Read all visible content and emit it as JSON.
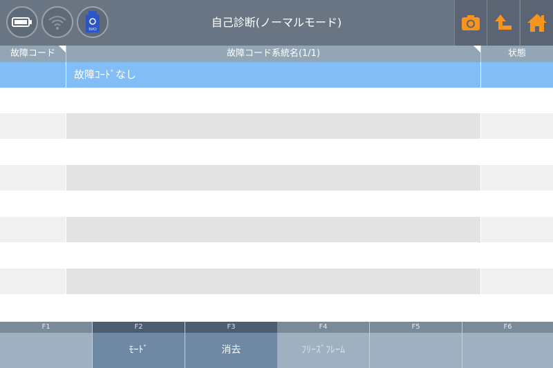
{
  "header": {
    "title": "自己診断(ノーマルモード)",
    "status_icons": [
      "battery-icon",
      "wifi-icon",
      "vci-device-icon"
    ],
    "vci_label": "SVCI",
    "actions": [
      "camera-icon",
      "back-up-icon",
      "home-icon"
    ],
    "accent": "#f7941d"
  },
  "table": {
    "columns": {
      "code": "故障コード",
      "name": "故障コード系統名(1/1)",
      "status": "状態"
    },
    "rows": [
      {
        "code": "",
        "name": "故障ｺｰﾄﾞなし",
        "status": ""
      }
    ]
  },
  "fkeys": [
    {
      "num": "F1",
      "label": ""
    },
    {
      "num": "F2",
      "label": "ﾓｰﾄﾞ"
    },
    {
      "num": "F3",
      "label": "消去"
    },
    {
      "num": "F4",
      "label": "ﾌﾘｰｽﾞﾌﾚｰﾑ"
    },
    {
      "num": "F5",
      "label": ""
    },
    {
      "num": "F6",
      "label": ""
    }
  ]
}
